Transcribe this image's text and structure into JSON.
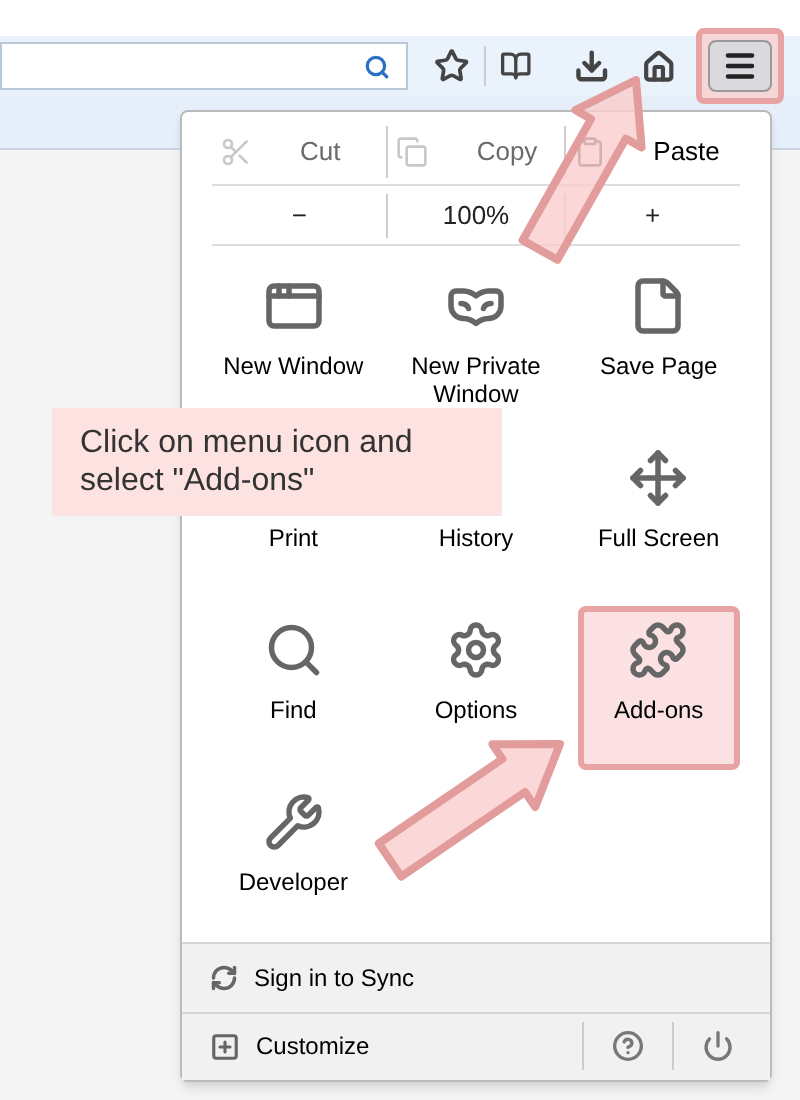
{
  "toolbar": {
    "menu_button": {
      "highlighted": true
    }
  },
  "menu": {
    "edit_row": [
      {
        "label": "Cut",
        "disabled": true
      },
      {
        "label": "Copy",
        "disabled": true
      },
      {
        "label": "Paste",
        "disabled": false
      }
    ],
    "zoom_row": [
      "−",
      "100%",
      "+"
    ],
    "items": [
      {
        "label": "New Window",
        "highlighted": false
      },
      {
        "label": "New Private Window",
        "highlighted": false
      },
      {
        "label": "Save Page",
        "highlighted": false
      },
      {
        "label": "Print",
        "highlighted": false
      },
      {
        "label": "History",
        "highlighted": false
      },
      {
        "label": "Full Screen",
        "highlighted": false
      },
      {
        "label": "Find",
        "highlighted": false
      },
      {
        "label": "Options",
        "highlighted": false
      },
      {
        "label": "Add-ons",
        "highlighted": true
      },
      {
        "label": "Developer",
        "highlighted": false
      }
    ],
    "footer": [
      {
        "label": "Sign in to Sync"
      },
      {
        "label": "Customize"
      }
    ]
  },
  "callout": {
    "text": "Click on menu icon and select \"Add-ons\""
  }
}
